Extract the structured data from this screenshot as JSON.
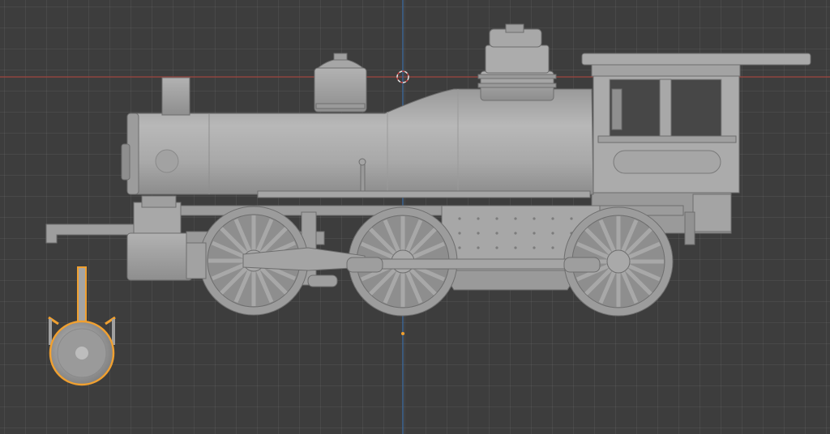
{
  "viewport": {
    "background": "#3d3d3d",
    "x_axis_color": "#a0453f",
    "z_axis_color": "#3d6ea6",
    "selection_color": "#f0a030",
    "mesh_color": "#a6a6a6"
  },
  "scene": {
    "objects": [
      "locomotive-model",
      "headlamp-model"
    ],
    "selected_object": "headlamp-model",
    "icons": [
      "3d-cursor-icon",
      "origin-point-icon"
    ]
  }
}
